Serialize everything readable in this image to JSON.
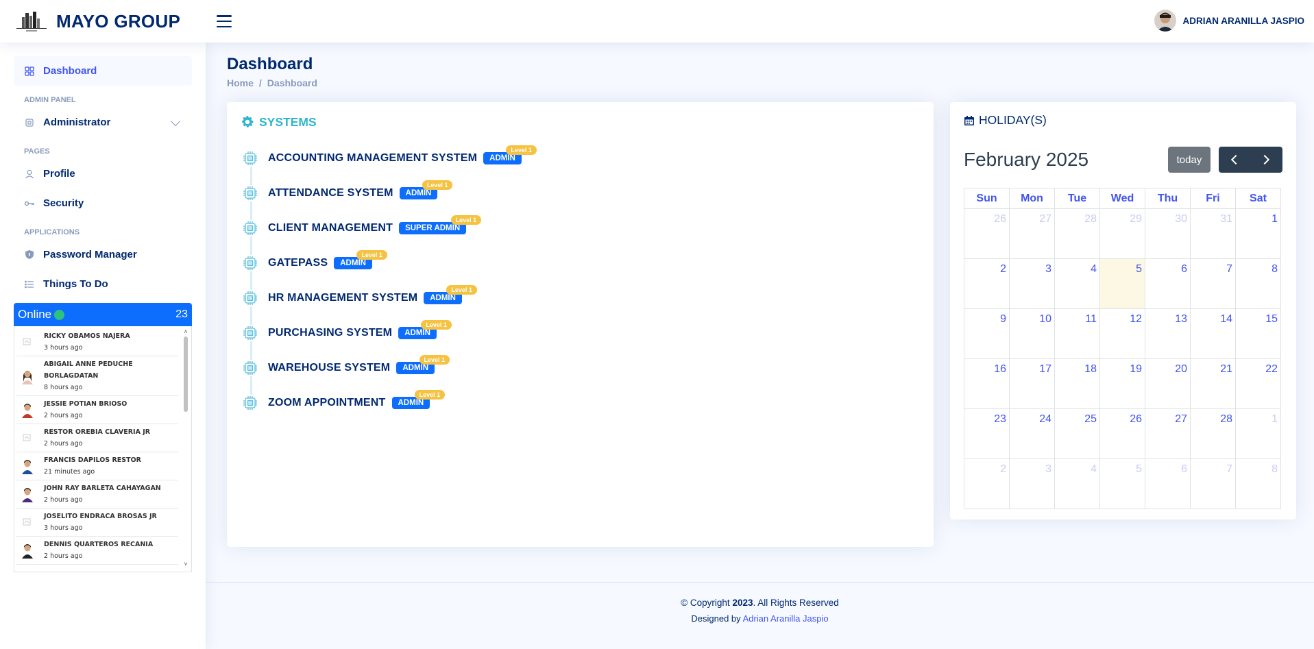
{
  "header": {
    "brand": "MAYO GROUP",
    "user_name": "ADRIAN ARANILLA JASPIO"
  },
  "sidebar": {
    "dashboard": "Dashboard",
    "heading_admin": "ADMIN PANEL",
    "administrator": "Administrator",
    "heading_pages": "PAGES",
    "profile": "Profile",
    "security": "Security",
    "heading_apps": "APPLICATIONS",
    "password_manager": "Password Manager",
    "things_to_do": "Things To Do"
  },
  "online": {
    "label": "Online",
    "count": "23",
    "users": [
      {
        "name": "RICKY OBAMOS NAJERA",
        "time": "3 hours ago",
        "avatar": "placeholder"
      },
      {
        "name": "ABIGAIL ANNE PEDUCHE BORLAGDATAN",
        "time": "8 hours ago",
        "avatar": "female"
      },
      {
        "name": "JESSIE POTIAN BRIOSO",
        "time": "2 hours ago",
        "avatar": "male-red"
      },
      {
        "name": "RESTOR OREBIA CLAVERIA JR",
        "time": "2 hours ago",
        "avatar": "placeholder"
      },
      {
        "name": "FRANCIS DAPILOS RESTOR",
        "time": "21 minutes ago",
        "avatar": "male-blue"
      },
      {
        "name": "JOHN RAY BARLETA CAHAYAGAN",
        "time": "2 hours ago",
        "avatar": "male-purple"
      },
      {
        "name": "JOSELITO ENDRACA BROSAS JR",
        "time": "3 hours ago",
        "avatar": "placeholder"
      },
      {
        "name": "DENNIS QUARTEROS RECANIA",
        "time": "2 hours ago",
        "avatar": "male-dark"
      }
    ]
  },
  "main": {
    "title": "Dashboard",
    "breadcrumb_home": "Home",
    "breadcrumb_sep": "/",
    "breadcrumb_current": "Dashboard"
  },
  "systems": {
    "title": "SYSTEMS",
    "items": [
      {
        "name": "ACCOUNTING MANAGEMENT SYSTEM",
        "role": "ADMIN",
        "level": "Level 1"
      },
      {
        "name": "ATTENDANCE SYSTEM",
        "role": "ADMIN",
        "level": "Level 1"
      },
      {
        "name": "CLIENT MANAGEMENT",
        "role": "SUPER ADMIN",
        "level": "Level 1"
      },
      {
        "name": "GATEPASS",
        "role": "ADMIN",
        "level": "Level 1"
      },
      {
        "name": "HR MANAGEMENT SYSTEM",
        "role": "ADMIN",
        "level": "Level 1"
      },
      {
        "name": "PURCHASING SYSTEM",
        "role": "ADMIN",
        "level": "Level 1"
      },
      {
        "name": "WAREHOUSE SYSTEM",
        "role": "ADMIN",
        "level": "Level 1"
      },
      {
        "name": "ZOOM APPOINTMENT",
        "role": "ADMIN",
        "level": "Level 1"
      }
    ]
  },
  "holiday": {
    "title": "HOLIDAY(S)",
    "month": "February 2025",
    "today_label": "today",
    "weekdays": [
      "Sun",
      "Mon",
      "Tue",
      "Wed",
      "Thu",
      "Fri",
      "Sat"
    ],
    "weeks": [
      [
        {
          "d": "26",
          "o": true
        },
        {
          "d": "27",
          "o": true
        },
        {
          "d": "28",
          "o": true
        },
        {
          "d": "29",
          "o": true
        },
        {
          "d": "30",
          "o": true
        },
        {
          "d": "31",
          "o": true
        },
        {
          "d": "1",
          "o": false
        }
      ],
      [
        {
          "d": "2",
          "o": false
        },
        {
          "d": "3",
          "o": false
        },
        {
          "d": "4",
          "o": false
        },
        {
          "d": "5",
          "o": false,
          "t": true
        },
        {
          "d": "6",
          "o": false
        },
        {
          "d": "7",
          "o": false
        },
        {
          "d": "8",
          "o": false
        }
      ],
      [
        {
          "d": "9",
          "o": false
        },
        {
          "d": "10",
          "o": false
        },
        {
          "d": "11",
          "o": false
        },
        {
          "d": "12",
          "o": false
        },
        {
          "d": "13",
          "o": false
        },
        {
          "d": "14",
          "o": false
        },
        {
          "d": "15",
          "o": false
        }
      ],
      [
        {
          "d": "16",
          "o": false
        },
        {
          "d": "17",
          "o": false
        },
        {
          "d": "18",
          "o": false
        },
        {
          "d": "19",
          "o": false
        },
        {
          "d": "20",
          "o": false
        },
        {
          "d": "21",
          "o": false
        },
        {
          "d": "22",
          "o": false
        }
      ],
      [
        {
          "d": "23",
          "o": false
        },
        {
          "d": "24",
          "o": false
        },
        {
          "d": "25",
          "o": false
        },
        {
          "d": "26",
          "o": false
        },
        {
          "d": "27",
          "o": false
        },
        {
          "d": "28",
          "o": false
        },
        {
          "d": "1",
          "o": true
        }
      ],
      [
        {
          "d": "2",
          "o": true
        },
        {
          "d": "3",
          "o": true
        },
        {
          "d": "4",
          "o": true
        },
        {
          "d": "5",
          "o": true
        },
        {
          "d": "6",
          "o": true
        },
        {
          "d": "7",
          "o": true
        },
        {
          "d": "8",
          "o": true
        }
      ]
    ]
  },
  "footer": {
    "copyright_prefix": "© Copyright ",
    "year": "2023",
    "copyright_suffix": ". All Rights Reserved",
    "designed_by": "Designed by ",
    "designer": "Adrian Aranilla Jaspio"
  }
}
